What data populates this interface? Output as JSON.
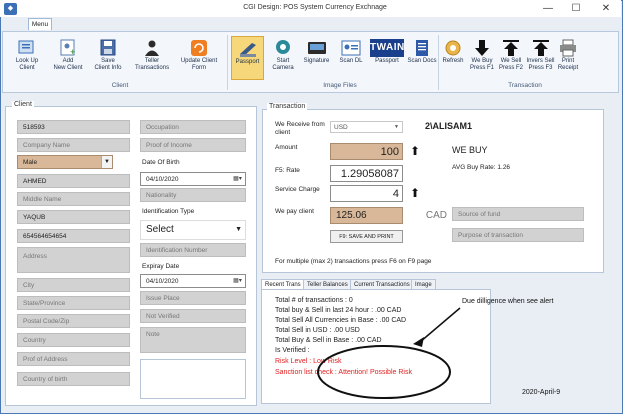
{
  "window": {
    "title": "CGI Design: POS System Currency Exchnage",
    "menu_tab": "Menu",
    "minimize": "—",
    "maximize": "☐",
    "close": "✕"
  },
  "ribbon": {
    "client_group": "Client",
    "image_group": "Image Files",
    "transaction_group": "Transaction",
    "buttons": [
      {
        "label1": "Look Up",
        "label2": "Client"
      },
      {
        "label1": "Add",
        "label2": "New Client"
      },
      {
        "label1": "Save",
        "label2": "Client Info"
      },
      {
        "label1": "Teller",
        "label2": "Transactions"
      },
      {
        "label1": "Update Client",
        "label2": "Form"
      },
      {
        "label1": "",
        "label2": "Passport"
      },
      {
        "label1": "Start",
        "label2": "Camera"
      },
      {
        "label1": "",
        "label2": "Signature"
      },
      {
        "label1": "",
        "label2": "Scan DL"
      },
      {
        "label1": "",
        "label2": "Passport"
      },
      {
        "label1": "",
        "label2": "Scan Docs"
      },
      {
        "label1": "",
        "label2": "Refresh"
      },
      {
        "label1": "We Buy",
        "label2": "Press F1"
      },
      {
        "label1": "We Sell",
        "label2": "Press F2"
      },
      {
        "label1": "Invers Sell",
        "label2": "Press F3"
      },
      {
        "label1": "Print",
        "label2": "Receipt"
      }
    ],
    "twain_logo": "TWAIN"
  },
  "client": {
    "section": "Client",
    "id": "518593",
    "company_name": "Company Name",
    "gender": "Male",
    "first_name": "AHMED",
    "middle_name": "Middle Name",
    "last_name": "YAQUB",
    "phone": "654564654654",
    "address": "Address",
    "city": "City",
    "state": "State/Province",
    "postal": "Postal Code/Zip",
    "country": "Country",
    "proof_address": "Prof of Address",
    "country_birth": "Country of birth",
    "occupation": "Occupation",
    "proof_income": "Proof of Income",
    "dob_label": "Date Of Birth",
    "dob": "04/10/2020",
    "nationality": "Nationality",
    "id_type_label": "Identification Type",
    "id_type": "Select",
    "id_number": "Identification Number",
    "expiry_label": "Expiray Date",
    "expiry": "04/10/2020",
    "issue_place": "Issue Place",
    "verified": "Not Verified",
    "note": "Note"
  },
  "transaction": {
    "section": "Transaction",
    "receive_label": "We Receive from client",
    "currency": "USD",
    "amount_label": "Amount",
    "amount": "100",
    "rate_label": "F5: Rate",
    "rate": "1.29058087",
    "service_label": "Service Charge",
    "service": "4",
    "pay_label": "We pay client",
    "pay_value": "125.06",
    "pay_currency": "CAD",
    "save_print": "F9: SAVE AND PRINT",
    "multi_note": "For multiple (max 2) transactions press F6 on F9 page",
    "user": "2\\ALISAM1",
    "mode": "WE BUY",
    "avg_rate": "AVG Buy Rate: 1.26",
    "source_fund": "Source of fund",
    "purpose": "Purpose of transaction"
  },
  "tabs": [
    "Recent Trans",
    "Teller Balances",
    "Current Transactions",
    "Image"
  ],
  "recent": {
    "lines": [
      "Total # of transactions : 0",
      "Total buy & Sell in last 24 hour : .00 CAD",
      "Total Sell All Currencies in Base : .00 CAD",
      "Total Sell in USD : .00 USD",
      "Total Buy & Sell in Base : .00 CAD",
      "Is Verified :"
    ],
    "risk": "Risk Level : Low Risk",
    "sanction": "Sanction list check : Attention!  Possible Risk"
  },
  "annotation": {
    "note": "Due dilligence when see alert",
    "date": "2020-April-9"
  }
}
